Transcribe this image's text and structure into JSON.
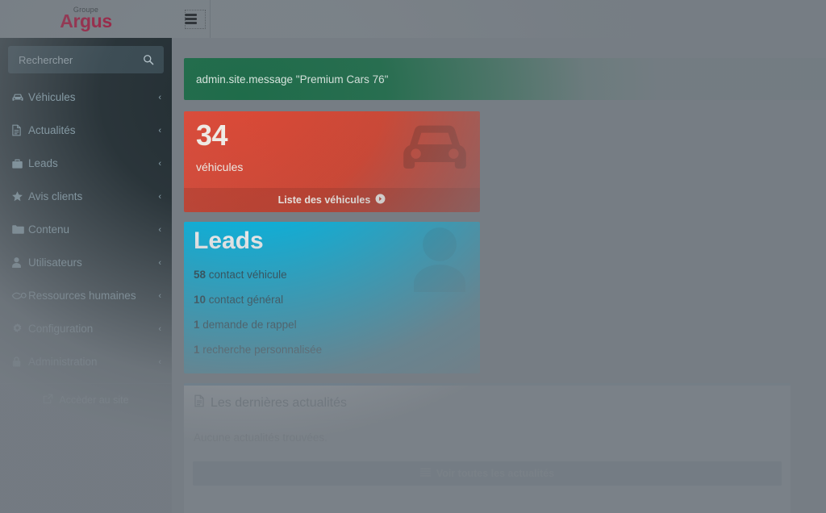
{
  "brand": {
    "logo_top": "Groupe",
    "logo_main": "Argus",
    "logo_color": "#a01b3f"
  },
  "sidebar": {
    "search": {
      "placeholder": "Rechercher",
      "value": "",
      "icon": "search-icon"
    },
    "items": [
      {
        "label": "Véhicules",
        "icon": "car-icon",
        "arrow": "‹"
      },
      {
        "label": "Actualités",
        "icon": "file-text-icon",
        "arrow": "‹"
      },
      {
        "label": "Leads",
        "icon": "briefcase-icon",
        "arrow": "‹"
      },
      {
        "label": "Avis clients",
        "icon": "star-icon",
        "arrow": "‹"
      },
      {
        "label": "Contenu",
        "icon": "folder-icon",
        "arrow": "‹"
      },
      {
        "label": "Utilisateurs",
        "icon": "user-icon",
        "arrow": "‹"
      },
      {
        "label": "Ressources humaines",
        "icon": "handshake-icon",
        "arrow": "‹"
      },
      {
        "label": "Configuration",
        "icon": "gear-icon",
        "arrow": "‹"
      },
      {
        "label": "Administration",
        "icon": "lock-icon",
        "arrow": "‹"
      }
    ],
    "site_link": {
      "label": "Accèder au site",
      "icon": "external-link-icon"
    }
  },
  "header": {
    "menu_toggle_icon": "hamburger-icon"
  },
  "alert": {
    "message": "admin.site.message \"Premium Cars 76\"",
    "color": "#1f6c4a"
  },
  "boxes": {
    "vehicles": {
      "number": "34",
      "label": "véhicules",
      "footer_label": "Liste des véhicules",
      "footer_icon": "arrow-circle-right-icon",
      "icon": "car-icon",
      "color": "#dd4b39"
    },
    "leads": {
      "title": "Leads",
      "icon": "user-icon",
      "color": "#00b5e2",
      "lines": [
        {
          "count": "58",
          "label": "contact véhicule"
        },
        {
          "count": "10",
          "label": "contact général"
        },
        {
          "count": "1",
          "label": "demande de rappel"
        },
        {
          "count": "1",
          "label": "recherche personnalisée"
        }
      ]
    }
  },
  "news_panel": {
    "title": "Les dernières actualités",
    "title_icon": "file-text-icon",
    "empty_message": "Aucune actualités trouvées.",
    "button_label": "Voir toutes les actualités",
    "button_icon": "list-icon",
    "accent_color": "#3c8dbc"
  }
}
